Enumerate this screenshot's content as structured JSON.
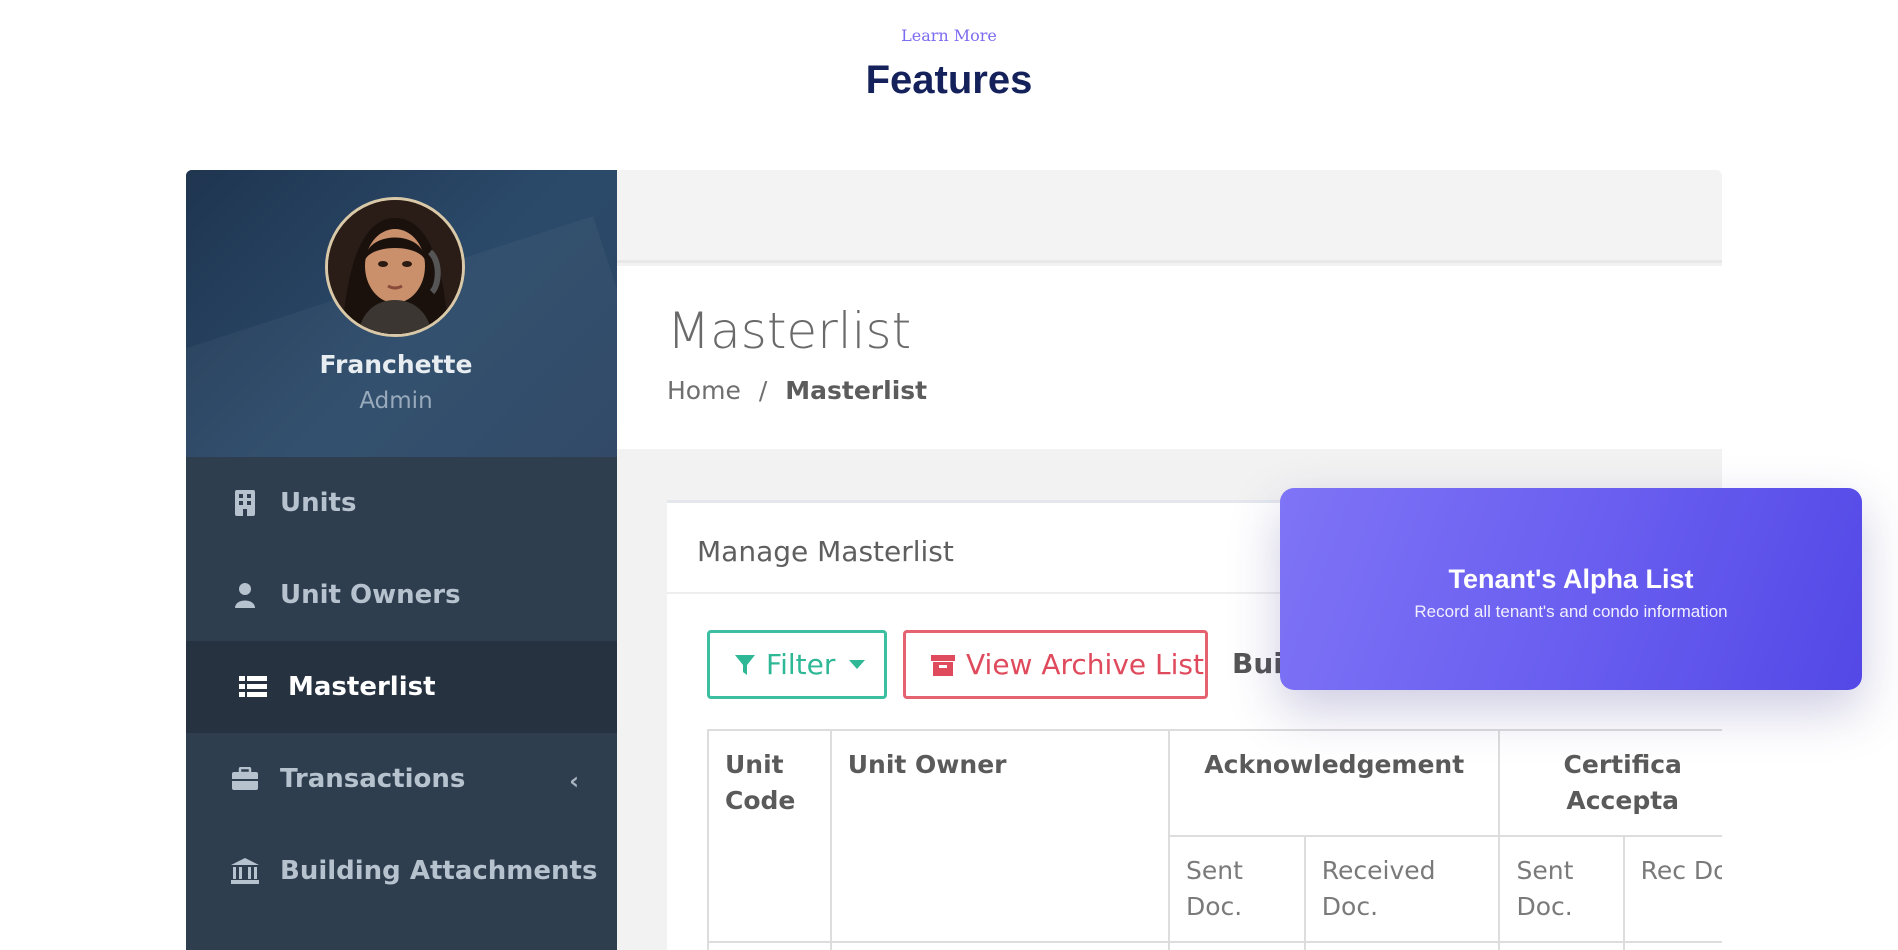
{
  "section": {
    "eyebrow": "Learn More",
    "heading": "Features"
  },
  "sidebar": {
    "user": {
      "name": "Franchette",
      "role": "Admin"
    },
    "items": [
      {
        "label": "Units",
        "icon": "building-icon",
        "active": false
      },
      {
        "label": "Unit Owners",
        "icon": "user-icon",
        "active": false
      },
      {
        "label": "Masterlist",
        "icon": "list-icon",
        "active": true
      },
      {
        "label": "Transactions",
        "icon": "briefcase-icon",
        "active": false,
        "has_submenu": true
      },
      {
        "label": "Building Attachments",
        "icon": "bank-icon",
        "active": false
      }
    ]
  },
  "main": {
    "page_title": "Masterlist",
    "breadcrumb": {
      "home": "Home",
      "separator": "/",
      "current": "Masterlist"
    },
    "panel": {
      "title": "Manage Masterlist",
      "filter_label": "Filter",
      "archive_label": "View Archive List",
      "truncated_label": "Bui",
      "table": {
        "headers": [
          "Unit Code",
          "Unit Owner",
          "Acknowledgement",
          "Certificate Acceptance"
        ],
        "visible_headers": [
          "Unit\nCode",
          "Unit Owner",
          "Acknowledgement",
          "Certifica\nAccepta"
        ],
        "subheaders": [
          "Sent Doc.",
          "Received Doc.",
          "Sent Doc.",
          "Rec Do"
        ]
      }
    }
  },
  "feature_card": {
    "title": "Tenant's Alpha List",
    "subtitle": "Record all tenant's and condo information"
  },
  "colors": {
    "accent_purple": "#6a5ff0",
    "heading_navy": "#14215a",
    "sidebar_bg": "#2f3e4f",
    "filter_green": "#2eb896",
    "archive_red": "#df4a5c"
  }
}
